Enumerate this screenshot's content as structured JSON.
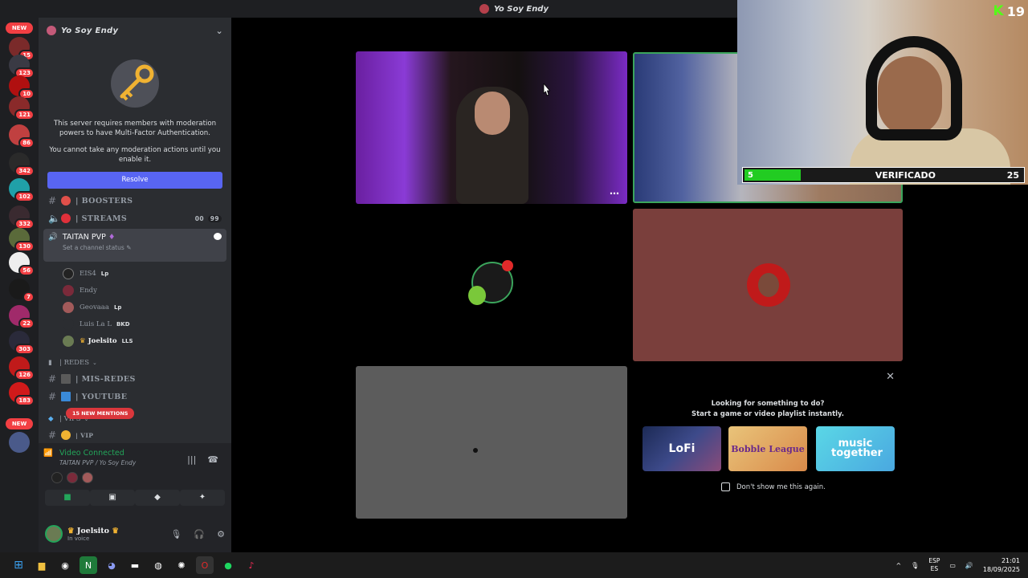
{
  "window": {
    "title": "Yo Soy Endy"
  },
  "servers": {
    "new_label_top": "NEW",
    "new_label_bottom": "NEW",
    "badges": [
      "15",
      "123",
      "10",
      "121",
      "86",
      "342",
      "102",
      "332",
      "130",
      "56",
      "7",
      "22",
      "303",
      "126",
      "183"
    ]
  },
  "sidebar": {
    "server_name": "Yo Soy Endy",
    "mfa_text_1": "This server requires members with moderation powers to have Multi-Factor Authentication.",
    "mfa_text_2": "You cannot take any moderation actions until you enable it.",
    "resolve_label": "Resolve",
    "channels": {
      "boosters": "| BOOSTERS",
      "streams": "| STREAMS",
      "streams_count_a": "00",
      "streams_count_b": "99",
      "voice_channel": "TAITAN PVP",
      "voice_status": "Set a channel status",
      "redes_category": "| REDES",
      "mis_redes": "| MIS-REDES",
      "youtube": "| YOUTUBE",
      "vips_category": "| VIPS",
      "vip": "| VIP"
    },
    "members": [
      {
        "name": "EIS4",
        "tag": "Lp"
      },
      {
        "name": "Endy",
        "tag": ""
      },
      {
        "name": "Geovaaa",
        "tag": "Lp"
      },
      {
        "name": "Luis La L",
        "tag": "BKD"
      },
      {
        "name": "Joelsito",
        "tag": "LLS"
      }
    ],
    "mentions_label": "15 NEW MENTIONS"
  },
  "voice_panel": {
    "status": "Video Connected",
    "location": "TAITAN PVP / Yo Soy Endy"
  },
  "user": {
    "name": "Joelsito",
    "status": "In voice"
  },
  "activity": {
    "question_1": "Looking for something to do?",
    "question_2": "Start a game or video playlist instantly.",
    "apps": [
      "LoFi",
      "Bobble League",
      "music together"
    ],
    "checkbox_label": "Don't show me this again."
  },
  "overlay": {
    "kick_count": "19",
    "verif_left": "5",
    "verif_label": "VERIFICADO",
    "verif_right": "25",
    "verif_progress": 0.2
  },
  "taskbar": {
    "lang_1": "ESP",
    "lang_2": "ES",
    "time": "21:01",
    "date": "18/09/2025"
  }
}
